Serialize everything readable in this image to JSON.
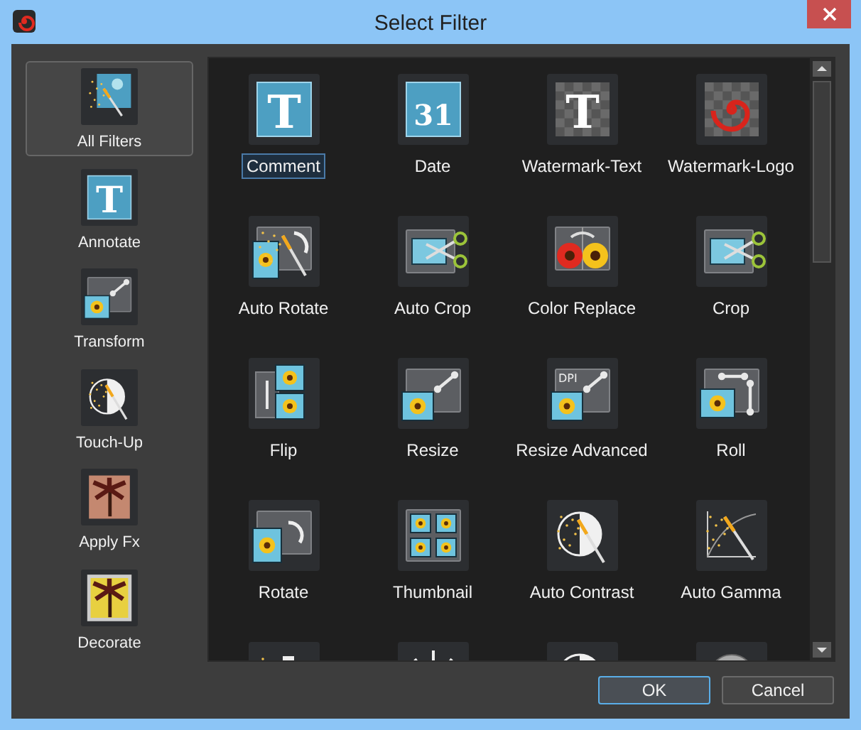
{
  "window": {
    "title": "Select Filter"
  },
  "sidebar": {
    "items": [
      {
        "label": "All Filters",
        "kind": "wand-photo",
        "selected": true
      },
      {
        "label": "Annotate",
        "kind": "text",
        "glyph": "T",
        "selected": false
      },
      {
        "label": "Transform",
        "kind": "resize",
        "selected": false
      },
      {
        "label": "Touch-Up",
        "kind": "contrast",
        "selected": false
      },
      {
        "label": "Apply Fx",
        "kind": "palm",
        "selected": false
      },
      {
        "label": "Decorate",
        "kind": "frame",
        "selected": false
      }
    ]
  },
  "filters": [
    {
      "label": "Comment",
      "kind": "text",
      "glyph": "T",
      "selected": true
    },
    {
      "label": "Date",
      "kind": "calendar",
      "glyph": "31",
      "selected": false
    },
    {
      "label": "Watermark-Text",
      "kind": "checker-text",
      "glyph": "T",
      "selected": false
    },
    {
      "label": "Watermark-Logo",
      "kind": "spiral",
      "selected": false
    },
    {
      "label": "Auto Rotate",
      "kind": "wand-rotate",
      "selected": false
    },
    {
      "label": "Auto Crop",
      "kind": "crop",
      "selected": false
    },
    {
      "label": "Color Replace",
      "kind": "color-replace",
      "selected": false
    },
    {
      "label": "Crop",
      "kind": "crop",
      "selected": false
    },
    {
      "label": "Flip",
      "kind": "flip",
      "selected": false
    },
    {
      "label": "Resize",
      "kind": "resize",
      "selected": false
    },
    {
      "label": "Resize Advanced",
      "kind": "resize",
      "glyph": "DPI",
      "selected": false
    },
    {
      "label": "Roll",
      "kind": "roll",
      "selected": false
    },
    {
      "label": "Rotate",
      "kind": "rotate",
      "selected": false
    },
    {
      "label": "Thumbnail",
      "kind": "thumbnail",
      "selected": false
    },
    {
      "label": "Auto Contrast",
      "kind": "contrast",
      "selected": false
    },
    {
      "label": "Auto Gamma",
      "kind": "gamma",
      "selected": false
    },
    {
      "kind": "sparkle"
    },
    {
      "kind": "sun"
    },
    {
      "kind": "half-circle"
    },
    {
      "kind": "disc"
    }
  ],
  "buttons": [
    {
      "label": "OK",
      "kind": "default"
    },
    {
      "label": "Cancel",
      "kind": "normal"
    }
  ]
}
